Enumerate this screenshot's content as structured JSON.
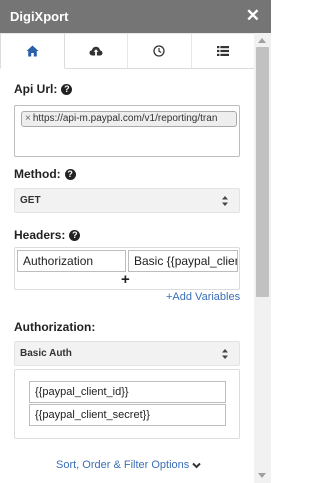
{
  "window": {
    "title": "DigiXport",
    "close_glyph": "✕"
  },
  "tabs": [
    {
      "name": "home",
      "icon": "home-icon",
      "active": true
    },
    {
      "name": "cloud-upload",
      "icon": "cloud-upload-icon",
      "active": false
    },
    {
      "name": "schedule",
      "icon": "clock-icon",
      "active": false
    },
    {
      "name": "list",
      "icon": "list-icon",
      "active": false
    }
  ],
  "api_url": {
    "label": "Api Url:",
    "help": "?",
    "chip_remove": "×",
    "value": "https://api-m.paypal.com/v1/reporting/tran"
  },
  "method": {
    "label": "Method:",
    "help": "?",
    "value": "GET"
  },
  "headers": {
    "label": "Headers:",
    "help": "?",
    "rows": [
      {
        "key": "Authorization",
        "value": "Basic {{paypal_client"
      }
    ],
    "add_row": "+",
    "add_variables": "+Add Variables"
  },
  "authorization": {
    "label": "Authorization:",
    "type": "Basic Auth",
    "username": "{{paypal_client_id}}",
    "password": "{{paypal_client_secret}}"
  },
  "sort_link": "Sort, Order & Filter Options",
  "colors": {
    "titlebar": "#757575",
    "link": "#3a6fb7",
    "active_tab_icon": "#2b5fa8"
  }
}
